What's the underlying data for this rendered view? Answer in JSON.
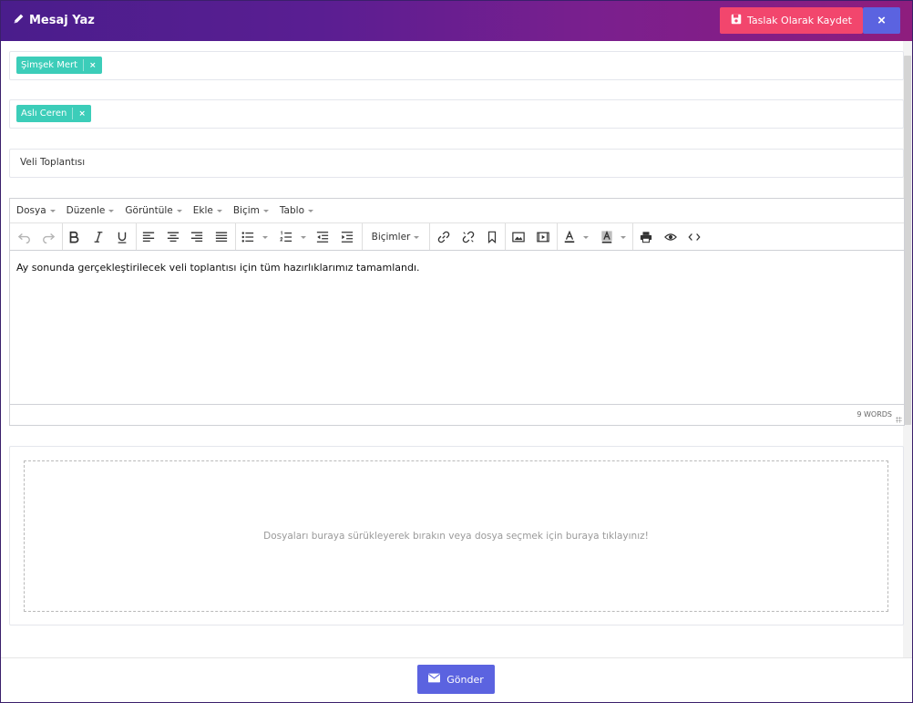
{
  "header": {
    "title": "Mesaj Yaz",
    "title_icon": "pencil-icon",
    "save_draft_label": "Taslak Olarak Kaydet",
    "save_draft_icon": "floppy-disk-icon",
    "close_label": "×",
    "colors": {
      "gradient_start": "#4a1d8c",
      "gradient_end": "#8e1d7e",
      "draft_button": "#f2466d",
      "close_button": "#5b63e0"
    }
  },
  "recipients": {
    "to_tags": [
      {
        "label": "Şimşek Mert",
        "remove": "×"
      }
    ],
    "cc_tags": [
      {
        "label": "Aslı Ceren",
        "remove": "×"
      }
    ],
    "tag_color": "#3ccdb9"
  },
  "subject": {
    "value": "Veli Toplantısı"
  },
  "editor": {
    "menu": [
      "Dosya",
      "Düzenle",
      "Görüntüle",
      "Ekle",
      "Biçim",
      "Tablo"
    ],
    "formats_label": "Biçimler",
    "toolbar_icons": [
      "undo-icon",
      "redo-icon",
      "bold-icon",
      "italic-icon",
      "underline-icon",
      "align-left-icon",
      "align-center-icon",
      "align-right-icon",
      "align-justify-icon",
      "bullet-list-icon",
      "numbered-list-icon",
      "outdent-icon",
      "indent-icon",
      "link-icon",
      "unlink-icon",
      "bookmark-icon",
      "image-icon",
      "media-icon",
      "text-color-icon",
      "background-color-icon",
      "print-icon",
      "preview-icon",
      "source-code-icon"
    ],
    "content": "Ay sonunda gerçekleştirilecek veli toplantısı için tüm hazırlıklarımız tamamlandı.",
    "word_count": "9 WORDS"
  },
  "upload": {
    "hint": "Dosyaları buraya sürükleyerek bırakın veya dosya seçmek için buraya tıklayınız!"
  },
  "footer": {
    "send_label": "Gönder",
    "send_icon": "envelope-icon",
    "send_color": "#5b63e0"
  }
}
